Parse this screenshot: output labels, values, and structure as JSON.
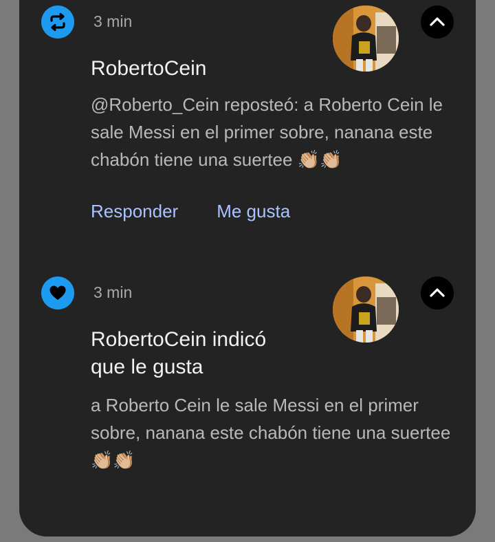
{
  "notifications": [
    {
      "icon": "repost-icon",
      "time": "3 min",
      "title": "RobertoCein",
      "body": "@Roberto_Cein reposteó: a Roberto Cein le sale Messi en el primer sobre, nanana este chabón tiene una suertee 👏🏼👏🏼",
      "actions": [
        "Responder",
        "Me gusta"
      ]
    },
    {
      "icon": "heart-icon",
      "time": "3 min",
      "title": "RobertoCein indicó que le gusta",
      "body": "a Roberto Cein le sale Messi en el primer sobre, nanana este chabón tiene una suertee 👏🏼👏🏼"
    }
  ],
  "colors": {
    "panel": "#232324",
    "app_icon": "#1d9bf0",
    "action_text": "#a9c3ff"
  }
}
